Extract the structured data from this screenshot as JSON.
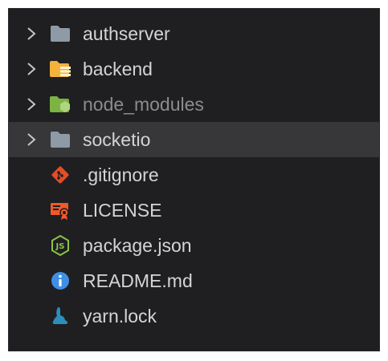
{
  "explorer": {
    "items": [
      {
        "label": "authserver",
        "kind": "folder",
        "icon": "folder-icon",
        "color": "#8e9aa6",
        "expanded": false
      },
      {
        "label": "backend",
        "kind": "folder",
        "icon": "folder-backend-icon",
        "color": "#f3b23b",
        "expanded": false
      },
      {
        "label": "node_modules",
        "kind": "folder",
        "icon": "folder-node-icon",
        "color": "#8bc34a",
        "expanded": false,
        "dimmed": true
      },
      {
        "label": "socketio",
        "kind": "folder",
        "icon": "folder-icon",
        "color": "#8e9aa6",
        "expanded": false,
        "selected": true
      },
      {
        "label": ".gitignore",
        "kind": "file",
        "icon": "git-icon",
        "color": "#e44d26"
      },
      {
        "label": "LICENSE",
        "kind": "file",
        "icon": "license-icon",
        "color": "#ef5a2a"
      },
      {
        "label": "package.json",
        "kind": "file",
        "icon": "nodejs-icon",
        "color": "#8bc34a"
      },
      {
        "label": "README.md",
        "kind": "file",
        "icon": "info-icon",
        "color": "#3f8fe6"
      },
      {
        "label": "yarn.lock",
        "kind": "file",
        "icon": "yarn-icon",
        "color": "#2c8ebb"
      }
    ]
  }
}
